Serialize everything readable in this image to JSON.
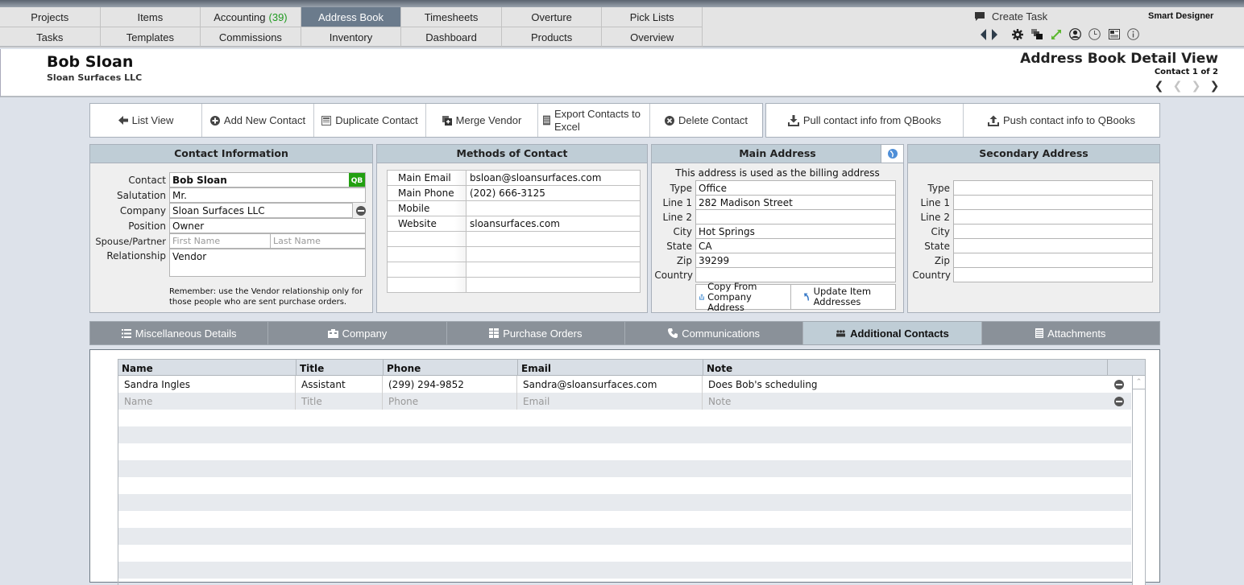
{
  "nav": {
    "row1": [
      {
        "label": "Projects"
      },
      {
        "label": "Items"
      },
      {
        "label": "Accounting",
        "count": "(39)"
      },
      {
        "label": "Address Book",
        "active": true
      },
      {
        "label": "Timesheets"
      },
      {
        "label": "Overture"
      },
      {
        "label": "Pick Lists"
      }
    ],
    "row2": [
      {
        "label": "Tasks"
      },
      {
        "label": "Templates"
      },
      {
        "label": "Commissions"
      },
      {
        "label": "Inventory"
      },
      {
        "label": "Dashboard"
      },
      {
        "label": "Products"
      },
      {
        "label": "Overview"
      }
    ],
    "create_task": "Create Task",
    "user_label": "Smart Designer",
    "tool_icons": [
      "back-arrow-icon",
      "forward-arrow-icon",
      "gear-icon",
      "windows-icon",
      "expand-icon",
      "user-icon",
      "clock-icon",
      "news-icon",
      "info-icon"
    ],
    "colors": {
      "active_tab": "#6b7b8c",
      "count": "#1f9a1f",
      "expand_icon": "#5cb82e"
    }
  },
  "header": {
    "contact_name": "Bob Sloan",
    "company_name": "Sloan Surfaces LLC",
    "page_title": "Address Book Detail View",
    "record_count": "Contact 1 of 2"
  },
  "actions": {
    "list_view": "List View",
    "add_new_contact": "Add New Contact",
    "duplicate_contact": "Duplicate Contact",
    "merge_vendor": "Merge Vendor",
    "export_contacts": "Export Contacts to Excel",
    "delete_contact": "Delete Contact",
    "pull_qbooks": "Pull contact info from QBooks",
    "push_qbooks": "Push contact info to QBooks"
  },
  "contact_info": {
    "title": "Contact Information",
    "contact_label": "Contact",
    "contact_value": "Bob Sloan",
    "qb_badge": "QB",
    "salutation_label": "Salutation",
    "salutation_value": "Mr.",
    "company_label": "Company",
    "company_value": "Sloan Surfaces LLC",
    "position_label": "Position",
    "position_value": "Owner",
    "spouse_label": "Spouse/Partner",
    "spouse_first_placeholder": "First Name",
    "spouse_last_placeholder": "Last Name",
    "relationship_label": "Relationship",
    "relationship_value": "Vendor",
    "note": "Remember: use the Vendor relationship only for those people who are sent purchase orders."
  },
  "methods_of_contact": {
    "title": "Methods of Contact",
    "rows": [
      {
        "label": "Main Email",
        "value": "bsloan@sloansurfaces.com"
      },
      {
        "label": "Main Phone",
        "value": "(202) 666-3125"
      },
      {
        "label": "Mobile",
        "value": ""
      },
      {
        "label": "Website",
        "value": "sloansurfaces.com"
      },
      {
        "label": "",
        "value": ""
      },
      {
        "label": "",
        "value": ""
      },
      {
        "label": "",
        "value": ""
      },
      {
        "label": "",
        "value": ""
      }
    ]
  },
  "main_address": {
    "title": "Main Address",
    "billing_note": "This address is used as the billing address",
    "fields": [
      {
        "label": "Type",
        "value": "Office"
      },
      {
        "label": "Line 1",
        "value": "282 Madison Street"
      },
      {
        "label": "Line 2",
        "value": ""
      },
      {
        "label": "City",
        "value": "Hot Springs"
      },
      {
        "label": "State",
        "value": "CA"
      },
      {
        "label": "Zip",
        "value": "39299"
      },
      {
        "label": "Country",
        "value": ""
      }
    ],
    "copy_button": "Copy From Company Address",
    "update_button": "Update Item Addresses"
  },
  "secondary_address": {
    "title": "Secondary Address",
    "fields": [
      {
        "label": "Type",
        "value": ""
      },
      {
        "label": "Line 1",
        "value": ""
      },
      {
        "label": "Line 2",
        "value": ""
      },
      {
        "label": "City",
        "value": ""
      },
      {
        "label": "State",
        "value": ""
      },
      {
        "label": "Zip",
        "value": ""
      },
      {
        "label": "Country",
        "value": ""
      }
    ]
  },
  "tabs": [
    {
      "label": "Miscellaneous Details",
      "icon": "list-icon"
    },
    {
      "label": "Company",
      "icon": "building-icon"
    },
    {
      "label": "Purchase Orders",
      "icon": "grid-icon"
    },
    {
      "label": "Communications",
      "icon": "phone-icon"
    },
    {
      "label": "Additional Contacts",
      "icon": "people-icon",
      "active": true
    },
    {
      "label": "Attachments",
      "icon": "document-icon"
    }
  ],
  "additional_contacts": {
    "columns": [
      "Name",
      "Title",
      "Phone",
      "Email",
      "Note"
    ],
    "rows": [
      {
        "name": "Sandra Ingles",
        "title": "Assistant",
        "phone": "(299) 294-9852",
        "email": "Sandra@sloansurfaces.com",
        "note": "Does Bob's scheduling"
      }
    ],
    "new_row_placeholders": {
      "name": "Name",
      "title": "Title",
      "phone": "Phone",
      "email": "Email",
      "note": "Note"
    }
  }
}
